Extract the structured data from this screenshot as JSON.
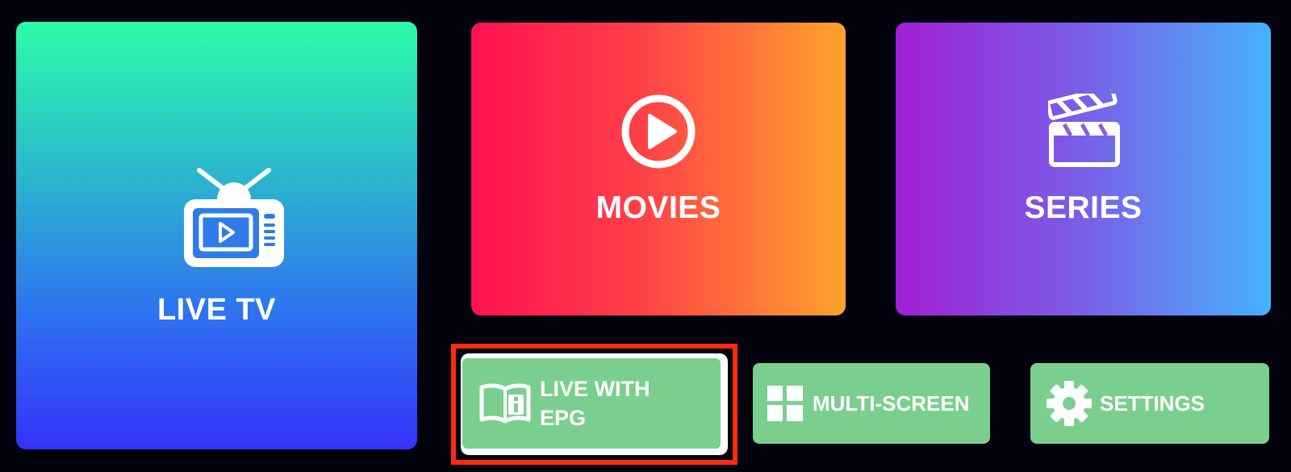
{
  "tiles": {
    "live_tv": {
      "label": "LIVE TV",
      "icon": "tv-icon",
      "gradient": [
        "#2cfca8",
        "#3433f8"
      ]
    },
    "movies": {
      "label": "MOVIES",
      "icon": "play-circle-icon",
      "gradient": [
        "#ff1250",
        "#ffa32c"
      ]
    },
    "series": {
      "label": "SERIES",
      "icon": "clapperboard-icon",
      "gradient": [
        "#a020d6",
        "#45b2fe"
      ]
    }
  },
  "buttons": {
    "live_epg": {
      "label_line1": "LIVE WITH",
      "label_line2": "EPG",
      "icon": "book-info-icon",
      "focused": true
    },
    "multi_screen": {
      "label": "MULTI-SCREEN",
      "icon": "grid-icon"
    },
    "settings": {
      "label": "SETTINGS",
      "icon": "gear-icon"
    }
  },
  "colors": {
    "background": "#03030f",
    "button": "#7bcf8e",
    "focus_border": "#ff2a10"
  }
}
